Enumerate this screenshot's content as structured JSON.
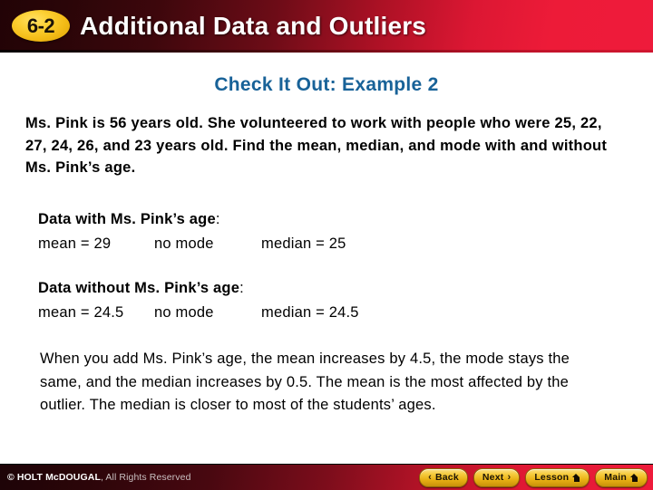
{
  "header": {
    "lesson_number": "6-2",
    "title": "Additional Data and Outliers"
  },
  "slide": {
    "example_heading": "Check It Out: Example 2",
    "problem_statement": "Ms. Pink is 56 years old. She volunteered to work with people who were 25, 22, 27, 24, 26, and 23 years old. Find the mean, median, and mode with and without Ms. Pink’s age.",
    "answers": [
      {
        "label": "Data with Ms. Pink’s age",
        "colon": ":",
        "mean": "mean = 29",
        "mode": "no mode",
        "median": "median = 25"
      },
      {
        "label": "Data without Ms. Pink’s age",
        "colon": ":",
        "mean": "mean = 24.5",
        "mode": "no mode",
        "median": "median = 24.5"
      }
    ],
    "conclusion": "When you add Ms. Pink’s age, the mean increases by 4.5, the mode stays the same, and the median increases by 0.5. The mean is the most affected by the outlier. The median is closer to most of the students’ ages."
  },
  "footer": {
    "copyright_brand": "© HOLT McDOUGAL",
    "copyright_rights": ", All Rights Reserved",
    "buttons": [
      {
        "label": "Back",
        "icon": "chevron-left-icon",
        "glyph": "‹"
      },
      {
        "label": "Next",
        "icon": "chevron-right-icon",
        "glyph": "›"
      },
      {
        "label": "Lesson",
        "icon": "home-icon",
        "glyph": ""
      },
      {
        "label": "Main",
        "icon": "home-icon",
        "glyph": ""
      }
    ]
  },
  "colors": {
    "header_red": "#ee1b3b",
    "header_dark": "#2a0508",
    "badge_gold": "#f3bb16",
    "heading_blue": "#186298",
    "button_gold": "#f6cc3f",
    "text_black": "#000000"
  }
}
